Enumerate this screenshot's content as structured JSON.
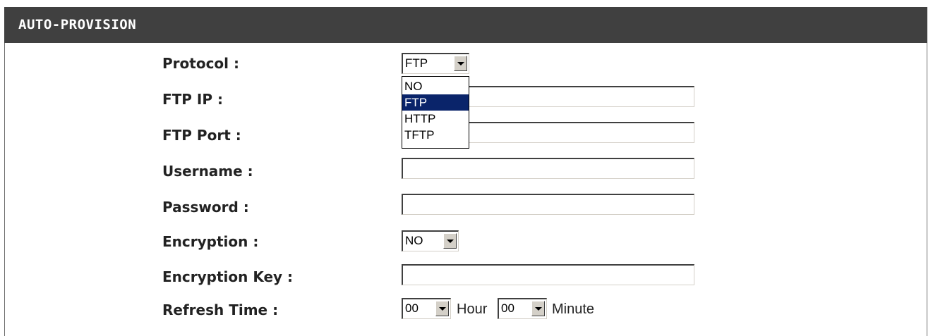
{
  "header": {
    "title": "AUTO-PROVISION"
  },
  "fields": {
    "protocol": {
      "label": "Protocol :",
      "value": "FTP"
    },
    "ftp_ip": {
      "label": "FTP IP :",
      "value": ""
    },
    "ftp_port": {
      "label": "FTP Port :",
      "value": ""
    },
    "username": {
      "label": "Username :",
      "value": ""
    },
    "password": {
      "label": "Password :",
      "value": ""
    },
    "encryption": {
      "label": "Encryption :",
      "value": "NO"
    },
    "encryption_key": {
      "label": "Encryption Key :",
      "value": ""
    },
    "refresh_time": {
      "label": "Refresh Time :",
      "hour_value": "00",
      "hour_unit": "Hour",
      "minute_value": "00",
      "minute_unit": "Minute"
    }
  },
  "protocol_dropdown": {
    "options": [
      "NO",
      "FTP",
      "HTTP",
      "TFTP"
    ],
    "highlighted": "FTP"
  },
  "colors": {
    "header_bg": "#404040",
    "highlight_bg": "#0a246a"
  }
}
